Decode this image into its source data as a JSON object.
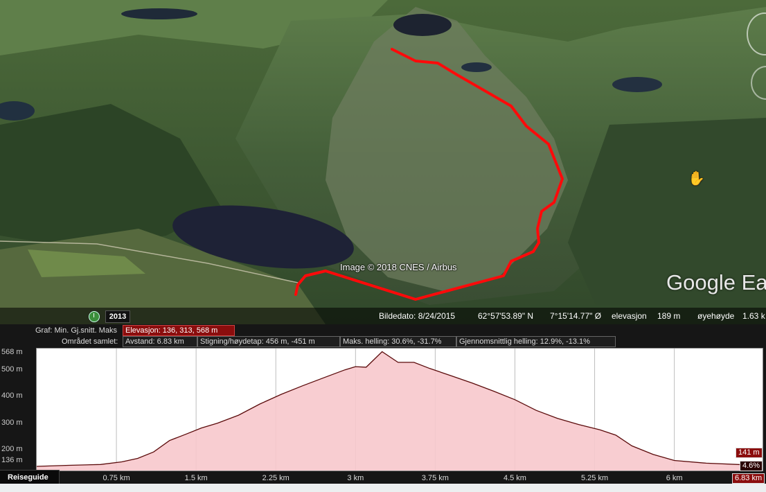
{
  "map": {
    "copyright": "Image © 2018 CNES / Airbus",
    "logo": "Google Ea",
    "year": "2013",
    "status": {
      "date_label": "Bildedato: 8/24/2015",
      "lat": "62°57'53.89\" N",
      "lon": "7°15'14.77\" Ø",
      "elev_label": "elevasjon",
      "elev_value": "189 m",
      "eye_label": "øyehøyde",
      "eye_value": "1.63 k"
    },
    "icons": [
      "clock-icon",
      "hand-cursor-icon",
      "navigation-ring-icon"
    ],
    "track_color": "#ff0a0a"
  },
  "graph": {
    "row1_label": "Graf: Min. Gj.snitt. Maks",
    "elevation": "Elevasjon: 136, 313, 568 m",
    "row2_label": "Området samlet:",
    "distance": "Avstand: 6.83 km",
    "climb": "Stigning/høydetap: 456 m, -451 m",
    "max_slope": "Maks. helling: 30.6%, -31.7%",
    "avg_slope": "Gjennomsnittlig helling: 12.9%, -13.1%",
    "end_elev": "141 m",
    "end_slope": "4.6%",
    "end_dist": "6.83 km",
    "reiseguide": "Reiseguide"
  },
  "chart_data": {
    "type": "area",
    "xlabel": "",
    "ylabel": "",
    "x_unit": "km",
    "y_unit": "m",
    "xlim": [
      0,
      6.83
    ],
    "ylim": [
      136,
      568
    ],
    "y_ticks": [
      "568 m",
      "500 m",
      "400 m",
      "300 m",
      "200 m",
      "136 m"
    ],
    "y_tick_values": [
      568,
      500,
      400,
      300,
      200,
      136
    ],
    "x_ticks": [
      "0.75 km",
      "1.5 km",
      "2.25 km",
      "3 km",
      "3.75 km",
      "4.5 km",
      "5.25 km",
      "6 km"
    ],
    "x_tick_values": [
      0.75,
      1.5,
      2.25,
      3,
      3.75,
      4.5,
      5.25,
      6
    ],
    "grid": true,
    "fill_color": "#f7c8cc",
    "line_color": "#5a0a0a",
    "series": [
      {
        "x": [
          0,
          0.3,
          0.6,
          0.8,
          0.95,
          1.1,
          1.25,
          1.4,
          1.55,
          1.7,
          1.9,
          2.1,
          2.3,
          2.5,
          2.7,
          2.9,
          3.0,
          3.1,
          3.25,
          3.4,
          3.55,
          3.7,
          3.9,
          4.1,
          4.3,
          4.5,
          4.7,
          4.9,
          5.1,
          5.3,
          5.45,
          5.6,
          5.8,
          6.0,
          6.3,
          6.6,
          6.83
        ],
        "y": [
          138,
          142,
          145,
          155,
          168,
          192,
          235,
          258,
          282,
          300,
          330,
          372,
          408,
          440,
          470,
          500,
          512,
          510,
          568,
          528,
          528,
          505,
          478,
          450,
          420,
          388,
          348,
          318,
          295,
          275,
          255,
          215,
          183,
          160,
          150,
          145,
          141
        ]
      }
    ]
  }
}
